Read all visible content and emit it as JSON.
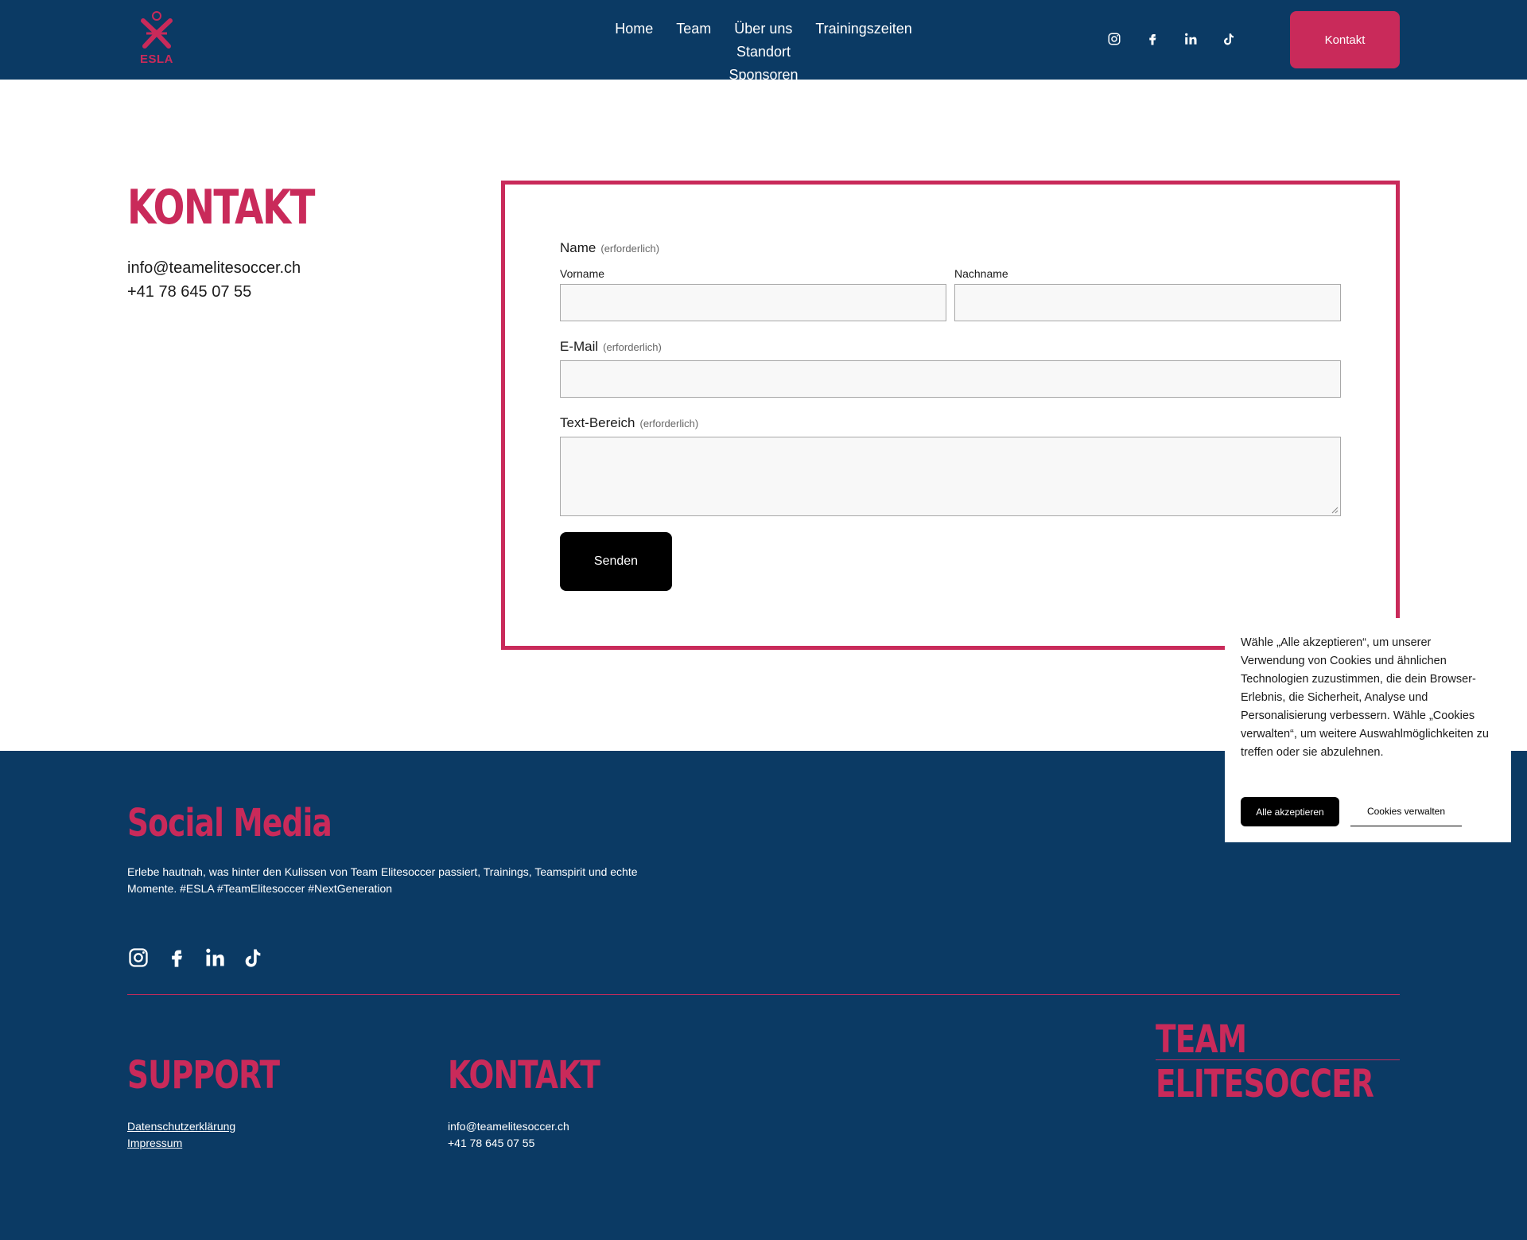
{
  "header": {
    "logo_text": "ESLA",
    "nav": [
      "Home",
      "Team",
      "Über uns",
      "Trainingszeiten",
      "Standort",
      "Sponsoren"
    ],
    "social_icons": [
      "instagram-icon",
      "facebook-icon",
      "linkedin-icon",
      "tiktok-icon"
    ],
    "cta_label": "Kontakt"
  },
  "contact": {
    "title": "KONTAKT",
    "email": "info@teamelitesoccer.ch",
    "phone": "+41 78 645 07 55"
  },
  "form": {
    "name_label": "Name",
    "required": "(erforderlich)",
    "firstname_label": "Vorname",
    "lastname_label": "Nachname",
    "email_label": "E-Mail",
    "textarea_label": "Text-Bereich",
    "submit_label": "Senden"
  },
  "footer": {
    "social_title": "Social Media",
    "social_text": "Erlebe hautnah, was hinter den Kulissen von Team Elitesoccer passiert, Trainings, Teamspirit und echte Momente. #ESLA #TeamElitesoccer #NextGeneration",
    "support_title": "SUPPORT",
    "support_links": [
      "Datenschutzerklärung",
      "Impressum"
    ],
    "kontakt_title": "KONTAKT",
    "email": "info@teamelitesoccer.ch",
    "phone": "+41 78 645 07 55",
    "brand": "TEAM ELITESOCCER"
  },
  "cookie": {
    "text": "Wähle „Alle akzeptieren“, um unserer Verwendung von Cookies und ähnlichen Technologien zuzustimmen, die dein Browser-Erlebnis, die Sicherheit, Analyse und Personalisierung verbessern. Wähle „Cookies verwalten“, um weitere Auswahlmöglichkeiten zu treffen oder sie abzulehnen.",
    "accept_label": "Alle akzeptieren",
    "manage_label": "Cookies verwalten"
  },
  "colors": {
    "navy": "#0b3a64",
    "accent": "#c92a5a"
  }
}
